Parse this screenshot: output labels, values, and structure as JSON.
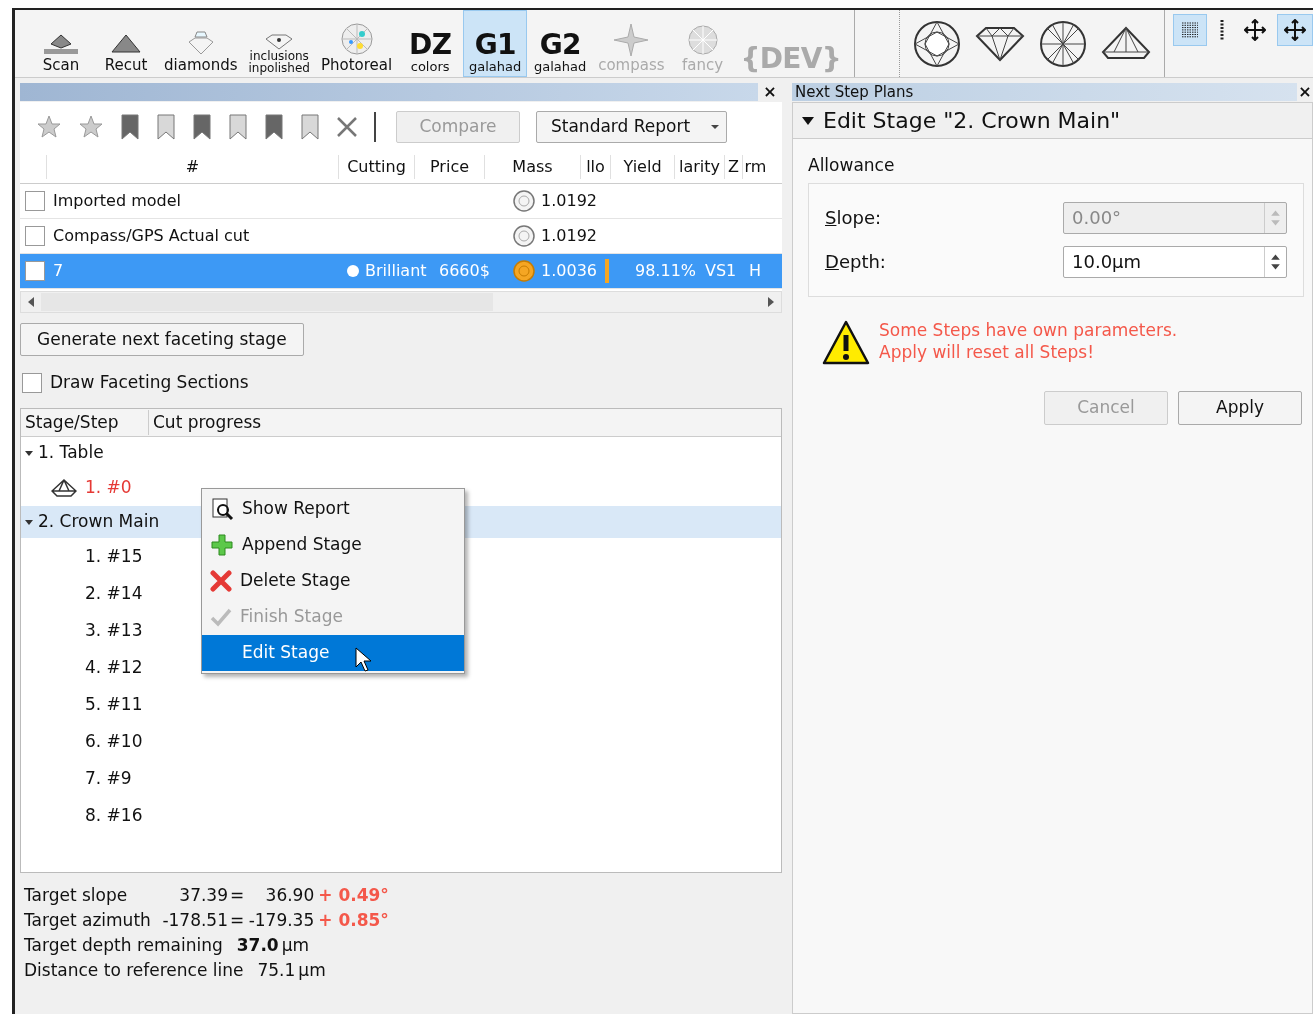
{
  "toolbar": {
    "tools": [
      {
        "kind": "scan",
        "lines": [
          "Scan"
        ],
        "selected": false,
        "disabled": false
      },
      {
        "kind": "recut",
        "lines": [
          "Recut"
        ],
        "selected": false,
        "disabled": false
      },
      {
        "kind": "diamond",
        "lines": [
          "diamonds"
        ],
        "selected": false,
        "disabled": false
      },
      {
        "kind": "inclusion",
        "lines": [
          "inclusions",
          "inpolished"
        ],
        "selected": false,
        "disabled": false
      },
      {
        "kind": "photoreal",
        "lines": [
          "Photoreal"
        ],
        "selected": false,
        "disabled": false
      },
      {
        "kind": "big",
        "big": "DZ",
        "lines": [
          "colors"
        ],
        "selected": false,
        "disabled": false
      },
      {
        "kind": "big",
        "big": "G1",
        "lines": [
          "galahad"
        ],
        "selected": true,
        "disabled": false
      },
      {
        "kind": "big",
        "big": "G2",
        "lines": [
          "galahad"
        ],
        "selected": false,
        "disabled": false
      },
      {
        "kind": "compass",
        "lines": [
          "compass"
        ],
        "selected": false,
        "disabled": true
      },
      {
        "kind": "fancy",
        "lines": [
          "fancy"
        ],
        "selected": false,
        "disabled": true
      },
      {
        "kind": "big",
        "big": "{DEV}",
        "selected": false,
        "disabled": true
      }
    ],
    "views": [
      {
        "kind": "top",
        "selected": false
      },
      {
        "kind": "side",
        "selected": false
      },
      {
        "kind": "bottom",
        "selected": false
      },
      {
        "kind": "pavilion",
        "selected": false
      }
    ],
    "modes": [
      {
        "kind": "grid",
        "selected": true
      },
      {
        "kind": "dots",
        "selected": false
      },
      {
        "kind": "move",
        "selected": false
      },
      {
        "kind": "move",
        "selected": true
      }
    ]
  },
  "left_panel": {
    "close": "×",
    "filters": [
      {
        "kind": "star",
        "selected": false
      },
      {
        "kind": "star",
        "selected": false
      },
      {
        "kind": "bookmark",
        "selected": true
      },
      {
        "kind": "bookmark",
        "selected": false
      },
      {
        "kind": "bookmark",
        "selected": true
      },
      {
        "kind": "bookmark",
        "selected": false
      },
      {
        "kind": "bookmark",
        "selected": true
      },
      {
        "kind": "bookmark",
        "selected": false
      },
      {
        "kind": "clear",
        "selected": false
      }
    ],
    "compare": {
      "label": "Compare",
      "disabled": true
    },
    "report": {
      "label": "Standard Report"
    },
    "columns": [
      "#",
      "Cutting",
      "Price",
      "Mass",
      "llo",
      "Yield",
      "larity",
      "Z",
      "rm"
    ],
    "rows": [
      {
        "name": "Imported model",
        "mass": "1.0192",
        "checked": false,
        "selected": false,
        "gem_marked": false
      },
      {
        "name": "Compass/GPS Actual cut",
        "mass": "1.0192",
        "checked": false,
        "selected": false,
        "gem_marked": false
      },
      {
        "name": "7",
        "cutting": "Brilliant",
        "price": "6660$",
        "mass": "1.0036",
        "yield": "98.11%",
        "clarity": "VS1",
        "color_grade": "H",
        "checked": false,
        "selected": true,
        "gem_marked": true,
        "dot": true,
        "bar": true
      }
    ],
    "generate_button": "Generate next faceting stage",
    "draw_sections": {
      "label": "Draw Faceting Sections",
      "checked": false
    },
    "tree_columns": [
      "Stage/Step",
      "Cut progress"
    ],
    "tree": [
      {
        "label": "1. Table",
        "expanded": true,
        "selected": false,
        "children": [
          {
            "label": "1. #0",
            "current": true,
            "icon": true,
            "selected": false
          }
        ]
      },
      {
        "label": "2. Crown Main",
        "expanded": true,
        "selected": true,
        "children": [
          {
            "label": "1. #15",
            "current": false,
            "icon": false,
            "selected": false
          },
          {
            "label": "2. #14",
            "current": false,
            "icon": false,
            "selected": false
          },
          {
            "label": "3. #13",
            "current": false,
            "icon": false,
            "selected": false
          },
          {
            "label": "4. #12",
            "current": false,
            "icon": false,
            "selected": false
          },
          {
            "label": "5. #11",
            "current": false,
            "icon": false,
            "selected": false
          },
          {
            "label": "6. #10",
            "current": false,
            "icon": false,
            "selected": false
          },
          {
            "label": "7. #9",
            "current": false,
            "icon": false,
            "selected": false
          },
          {
            "label": "8. #16",
            "current": false,
            "icon": false,
            "selected": false
          }
        ]
      }
    ],
    "context_menu": [
      {
        "kind": "report",
        "label": "Show Report",
        "disabled": false,
        "selected": false
      },
      {
        "kind": "append",
        "label": "Append Stage",
        "disabled": false,
        "selected": false
      },
      {
        "kind": "delete",
        "label": "Delete Stage",
        "disabled": false,
        "selected": false
      },
      {
        "kind": "finish",
        "label": "Finish Stage",
        "disabled": true,
        "selected": false
      },
      {
        "kind": "edit",
        "label": "Edit Stage",
        "disabled": false,
        "selected": true
      }
    ],
    "stats": [
      {
        "label": "Target slope",
        "value": "37.39",
        "equals": "=",
        "base": "36.90",
        "delta": "+ 0.49°"
      },
      {
        "label": "Target azimuth",
        "value": "-178.51",
        "equals": "=",
        "base": "-179.35",
        "delta": "+ 0.85°"
      },
      {
        "label": "Target depth remaining",
        "value": "37.0",
        "unit": "µm",
        "bold": true
      },
      {
        "label": "Distance to reference line",
        "value": "75.1",
        "unit": "µm",
        "bold": false
      }
    ]
  },
  "right_panel": {
    "title": "Next Step Plans",
    "close": "×",
    "section": "Edit Stage \"2. Crown Main\"",
    "expanded": true,
    "group": "Allowance",
    "fields": [
      {
        "label": "Slope:",
        "value": "0.00°",
        "disabled": true
      },
      {
        "label": "Depth:",
        "value": "10.0µm",
        "disabled": false
      }
    ],
    "warning": [
      "Some Steps have own parameters.",
      "Apply will reset all Steps!"
    ],
    "buttons": [
      {
        "label": "Cancel",
        "disabled": true
      },
      {
        "label": "Apply",
        "disabled": false
      }
    ]
  }
}
